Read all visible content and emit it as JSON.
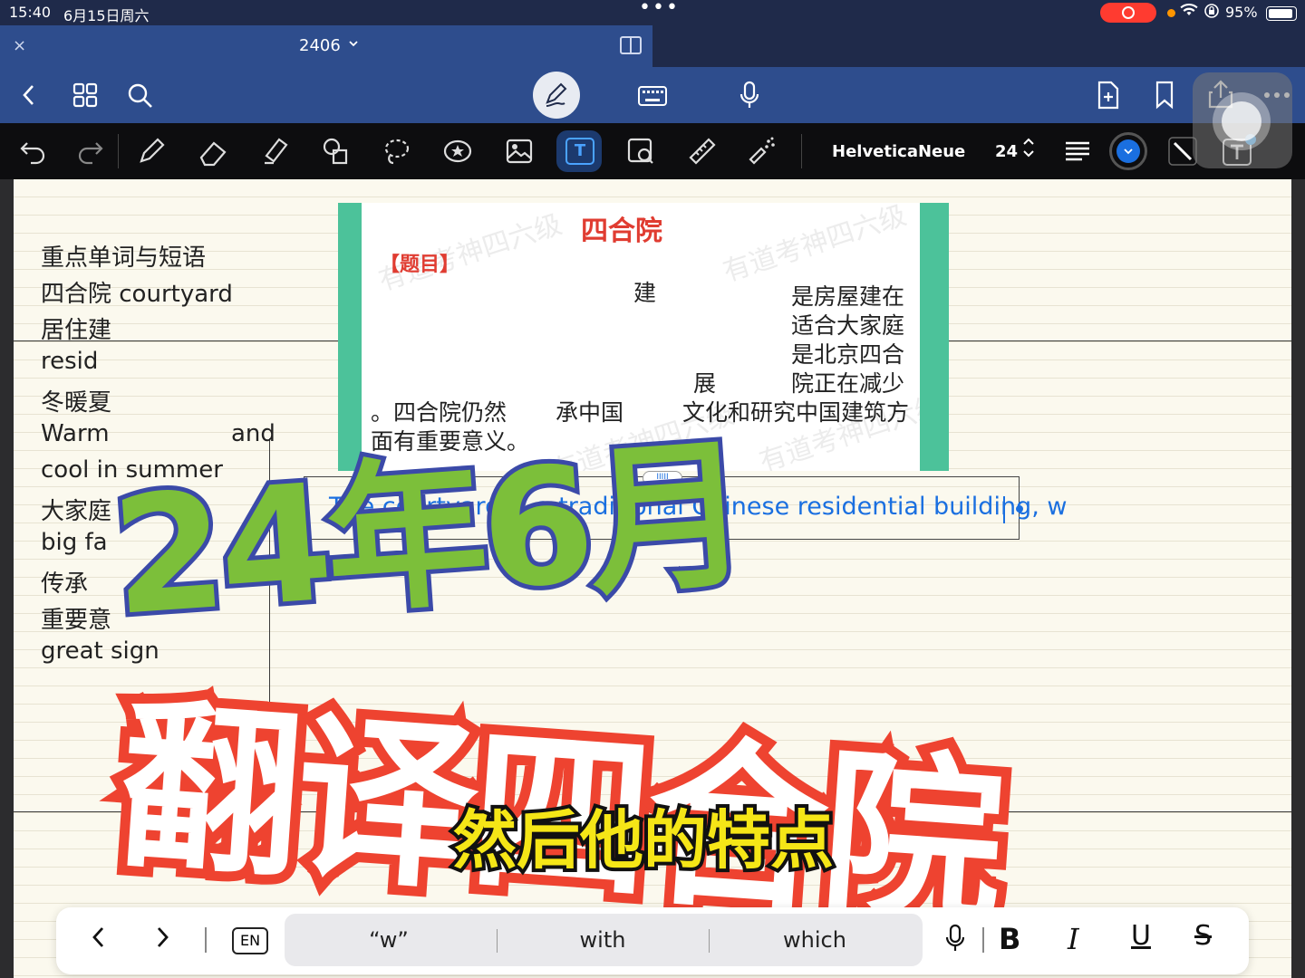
{
  "status_bar": {
    "time": "15:40",
    "date": "6月15日周六",
    "battery": "95%",
    "dots": "•••"
  },
  "tab": {
    "title": "2406",
    "close": "×",
    "chevron": "⌄"
  },
  "toolbar": {
    "font_name": "HelveticaNeue",
    "font_size": "24",
    "text_tool_glyph": "T",
    "text_box_glyph": "T"
  },
  "notes": {
    "lines": [
      "重点单词与短语",
      "四合院 courtyard",
      "居住建",
      "resid",
      "冬暖夏",
      "Warm",
      "cool in summer",
      "大家庭",
      "big fa",
      "传承",
      "重要意",
      "great sign"
    ],
    "and_fragment": "and"
  },
  "exam_image": {
    "title": "四合院",
    "tag": "【题目】",
    "visible_fragments": [
      "建",
      "是房屋建在",
      "适合大家庭",
      "是北京四合",
      "展",
      "院正在减少",
      "。四合院仍然",
      "承中国",
      "文化和研究中国建筑方",
      "面有重要意义。"
    ],
    "watermark": "有道考神四六级"
  },
  "text_box": {
    "typed": "The courtyard is a traditional Chinese residential building, w",
    "handle": "IIIII"
  },
  "overlays": {
    "date_banner": "24年6月",
    "title_banner": "翻译四合院",
    "subtitle": "然后他的特点"
  },
  "shortcut_bar": {
    "prev": "<",
    "next": ">",
    "lang": "EN",
    "suggestions": [
      "“w”",
      "with",
      "which"
    ],
    "bold": "B",
    "italic": "I",
    "underline": "U",
    "strike": "S"
  },
  "colors": {
    "nav_blue": "#2e4d8d",
    "ink_blue": "#1a6fe0",
    "paper": "#fbf9ee",
    "banner_green": "#7cbf3a",
    "banner_red": "#ee4330",
    "subtitle_yellow": "#f5e617"
  }
}
